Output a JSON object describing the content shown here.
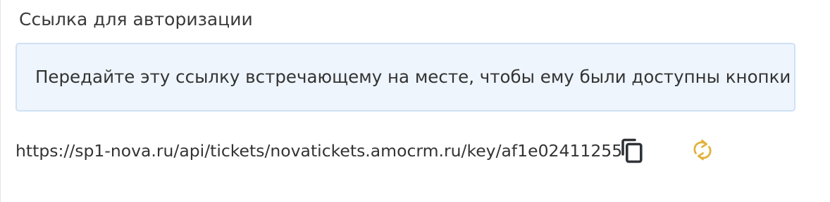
{
  "auth_section": {
    "title": "Ссылка для авторизации",
    "info_text": "Передайте эту ссылку встречающему на месте, чтобы ему были доступны кнопки",
    "link": "https://sp1-nova.ru/api/tickets/novatickets.amocrm.ru/key/af1e02411255",
    "copy_icon": "copy-icon",
    "refresh_icon": "refresh-icon"
  },
  "colors": {
    "info_background": "#eef5fd",
    "info_border": "#cfe1f4",
    "refresh_accent": "#e3b23c",
    "icon_dark": "#2f3338"
  }
}
